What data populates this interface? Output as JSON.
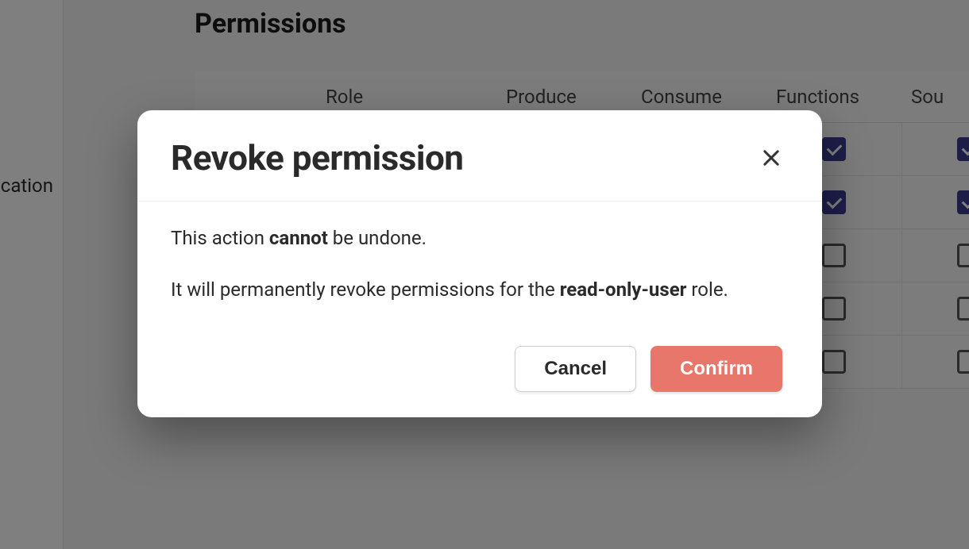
{
  "sidebar": {
    "item_fragment": "cation"
  },
  "page": {
    "section_title": "Permissions",
    "table": {
      "columns": [
        "Role",
        "Produce",
        "Consume",
        "Functions",
        "Sou"
      ],
      "rows": [
        {
          "role": "",
          "produce": false,
          "consume": false,
          "functions": true,
          "sources": true
        },
        {
          "role": "",
          "produce": false,
          "consume": false,
          "functions": true,
          "sources": true
        },
        {
          "role": "",
          "produce": false,
          "consume": false,
          "functions": false,
          "sources": false
        },
        {
          "role": "",
          "produce": false,
          "consume": false,
          "functions": false,
          "sources": false
        },
        {
          "role": "",
          "produce": false,
          "consume": false,
          "functions": false,
          "sources": false
        }
      ]
    }
  },
  "modal": {
    "title": "Revoke permission",
    "body_line1_before": "This action ",
    "body_line1_strong": "cannot",
    "body_line1_after": " be undone.",
    "body_line2_before": "It will permanently revoke permissions for the ",
    "body_line2_strong": "read-only-user",
    "body_line2_after": " role.",
    "cancel_label": "Cancel",
    "confirm_label": "Confirm"
  }
}
